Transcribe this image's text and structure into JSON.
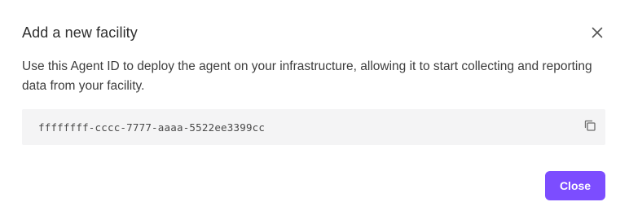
{
  "dialog": {
    "title": "Add a new facility",
    "description": "Use this Agent ID to deploy the agent on your infrastructure, allowing it to start collecting and reporting data from your facility.",
    "agent_id": "ffffffff-cccc-7777-aaaa-5522ee3399cc",
    "close_button_label": "Close",
    "icons": {
      "dismiss": "close-icon",
      "copy": "copy-icon"
    },
    "colors": {
      "accent": "#7c4dff",
      "id_box_background": "#f4f4f5",
      "title_text": "#2f2f2f"
    }
  }
}
